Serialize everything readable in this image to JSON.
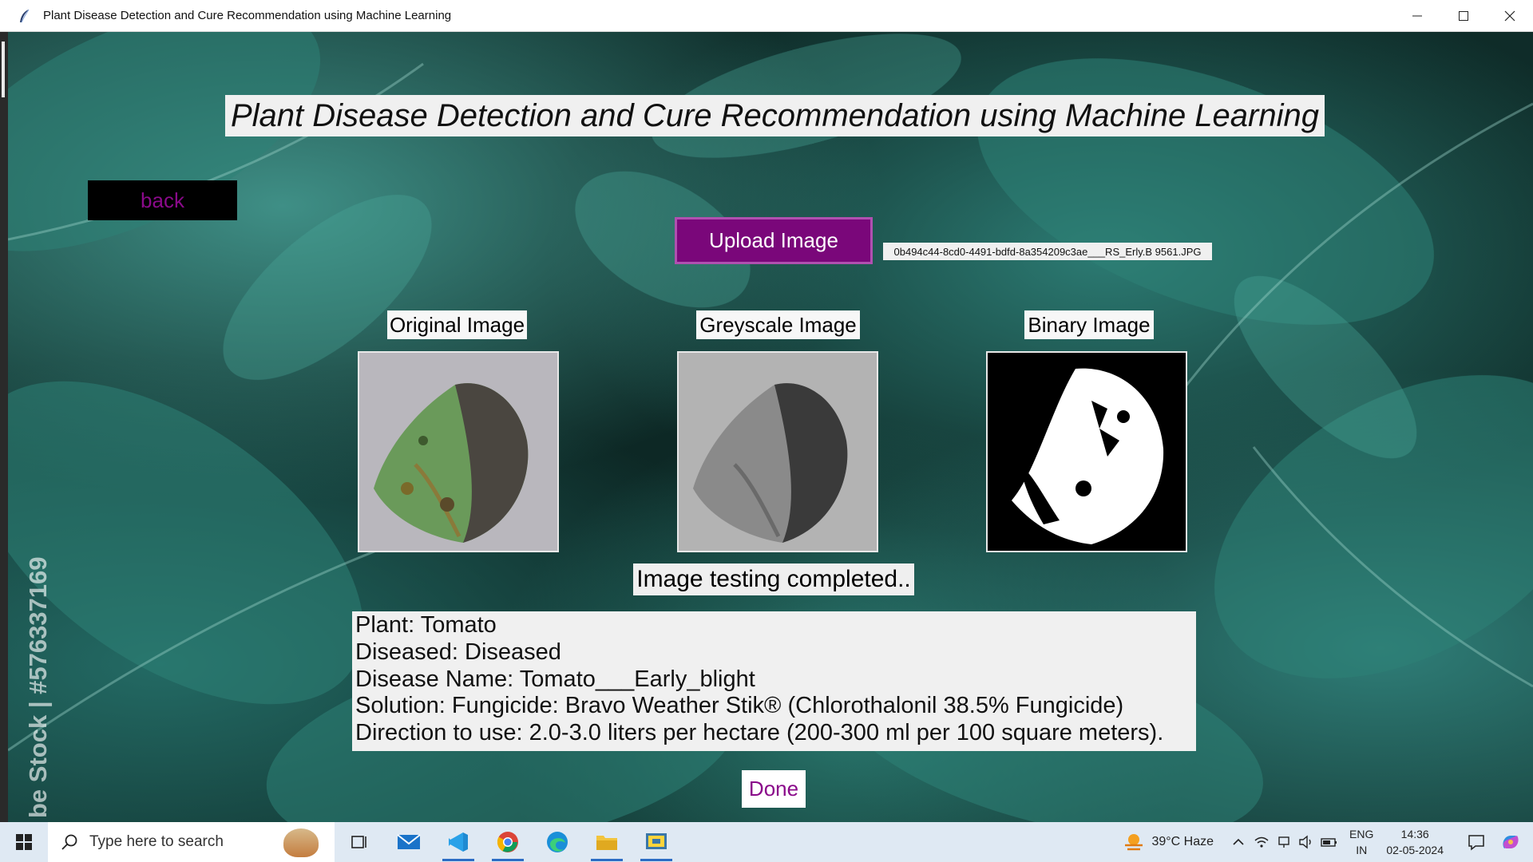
{
  "window": {
    "title": "Plant Disease Detection and Cure Recommendation using Machine Learning",
    "controls": [
      "minimize",
      "maximize",
      "close"
    ]
  },
  "background": {
    "watermark": "be Stock | #576337169"
  },
  "app": {
    "heading": "Plant Disease Detection and Cure Recommendation using Machine Learning",
    "back_label": "back",
    "upload_label": "Upload Image",
    "filename": "0b494c44-8cd0-4491-bdfd-8a354209c3ae___RS_Erly.B 9561.JPG",
    "images": {
      "original_label": "Original Image",
      "greyscale_label": "Greyscale Image",
      "binary_label": "Binary Image"
    },
    "status": "Image testing completed..",
    "result": {
      "plant": "Plant: Tomato",
      "diseased": "Diseased: Diseased",
      "disease_name": "Disease Name: Tomato___Early_blight",
      "solution": "Solution: Fungicide: Bravo Weather Stik® (Chlorothalonil 38.5% Fungicide)",
      "direction": "Direction to use: 2.0-3.0 liters per hectare (200-300 ml per 100 square meters)."
    },
    "done_label": "Done"
  },
  "taskbar": {
    "search_placeholder": "Type here to search",
    "apps": [
      "task-view",
      "mail",
      "visual-studio-code",
      "chrome",
      "edge",
      "file-explorer",
      "python-app"
    ],
    "weather": "39°C  Haze",
    "lang_line1": "ENG",
    "lang_line2": "IN",
    "time": "14:36",
    "date": "02-05-2024"
  },
  "colors": {
    "accent": "#7a077a",
    "back_text": "#8a0a8a",
    "taskbar": "#dfe9f3"
  }
}
